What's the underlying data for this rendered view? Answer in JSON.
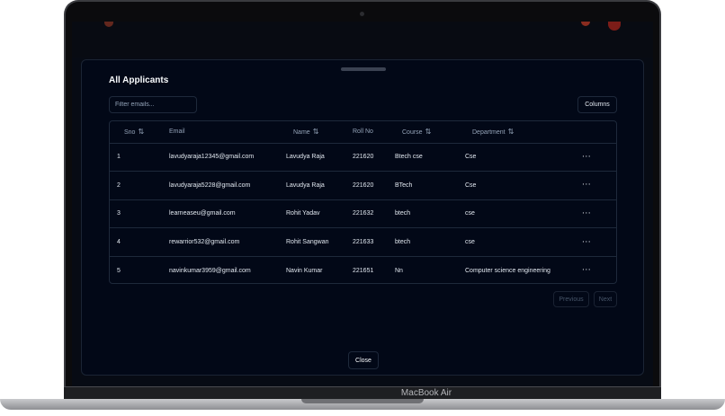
{
  "dialog": {
    "title": "All Applicants",
    "filter_placeholder": "Filter emails...",
    "columns_label": "Columns",
    "close_label": "Close"
  },
  "table": {
    "headers": {
      "sno": "Sno",
      "email": "Email",
      "name": "Name",
      "roll": "Roll No",
      "course": "Course",
      "department": "Department"
    },
    "rows": [
      {
        "sno": "1",
        "email": "lavudyaraja12345@gmail.com",
        "name": "Lavudya Raja",
        "roll": "221620",
        "course": "Btech cse",
        "department": "Cse"
      },
      {
        "sno": "2",
        "email": "lavudyaraja5228@gmail.com",
        "name": "Lavudya Raja",
        "roll": "221620",
        "course": "BTech",
        "department": "Cse"
      },
      {
        "sno": "3",
        "email": "learneaseu@gmail.com",
        "name": "Rohit Yadav",
        "roll": "221632",
        "course": "btech",
        "department": "cse"
      },
      {
        "sno": "4",
        "email": "rewarrior532@gmail.com",
        "name": "Rohit Sangwan",
        "roll": "221633",
        "course": "btech",
        "department": "cse"
      },
      {
        "sno": "5",
        "email": "navinkumar3959@gmail.com",
        "name": "Navin Kumar",
        "roll": "221651",
        "course": "Nn",
        "department": "Computer science engineering"
      }
    ],
    "actions_glyph": "···",
    "sort_glyph": "⇅"
  },
  "pagination": {
    "previous_label": "Previous",
    "next_label": "Next"
  },
  "device": {
    "model_label": "MacBook Air"
  },
  "colors": {
    "background": "#020817",
    "border": "#1e293b",
    "text": "#e2e8f0",
    "muted": "#94a3b8"
  }
}
